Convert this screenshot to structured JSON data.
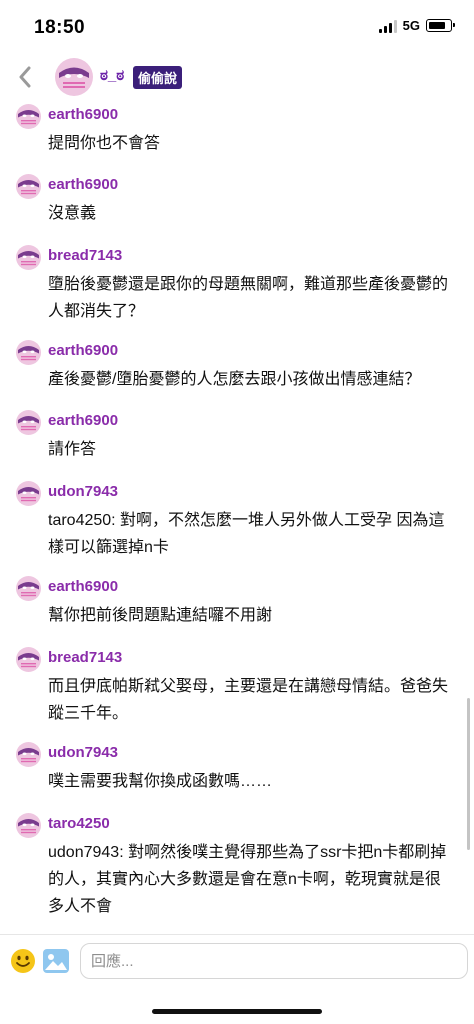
{
  "status_bar": {
    "time": "18:50",
    "network": "5G"
  },
  "header": {
    "name": "ಠ_ಠ",
    "badge": "偷偷說"
  },
  "messages": [
    {
      "user": "earth6900",
      "text": "提問你也不會答"
    },
    {
      "user": "earth6900",
      "text": "沒意義"
    },
    {
      "user": "bread7143",
      "text": "墮胎後憂鬱還是跟你的母題無關啊，難道那些產後憂鬱的人都消失了？"
    },
    {
      "user": "earth6900",
      "text": "產後憂鬱/墮胎憂鬱的人怎麼去跟小孩做出情感連結？"
    },
    {
      "user": "earth6900",
      "text": "請作答"
    },
    {
      "user": "udon7943",
      "text": "taro4250: 對啊，不然怎麼一堆人另外做人工受孕 因為這樣可以篩選掉n卡"
    },
    {
      "user": "earth6900",
      "text": "幫你把前後問題點連結囉不用謝"
    },
    {
      "user": "bread7143",
      "text": "而且伊底帕斯弒父娶母，主要還是在講戀母情結。爸爸失蹤三千年。"
    },
    {
      "user": "udon7943",
      "text": "噗主需要我幫你換成函數嗎……"
    },
    {
      "user": "taro4250",
      "text": "udon7943: 對啊然後噗主覺得那些為了ssr卡把n卡都刷掉的人，其實內心大多數還是會在意n卡啊，乾現實就是很多人不會"
    }
  ],
  "input": {
    "placeholder": "回應..."
  },
  "icons": {
    "back": "chevron-left-icon",
    "emoji": "smiley-icon",
    "image": "image-icon",
    "avatar": "masked-face-avatar"
  },
  "colors": {
    "username": "#8a2caa",
    "badge_bg": "#3b1f7a",
    "avatar_pink": "#e9b8d8",
    "avatar_purple": "#7a3c8e"
  }
}
